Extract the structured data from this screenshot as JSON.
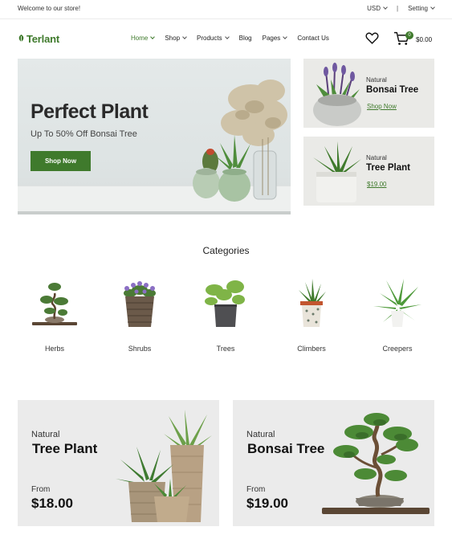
{
  "topbar": {
    "welcome": "Welcome to our store!",
    "currency": "USD",
    "separator": "|",
    "setting": "Setting"
  },
  "header": {
    "logo": "Terlant",
    "nav": [
      {
        "label": "Home",
        "dropdown": true,
        "active": true
      },
      {
        "label": "Shop",
        "dropdown": true
      },
      {
        "label": "Products",
        "dropdown": true
      },
      {
        "label": "Blog",
        "dropdown": false
      },
      {
        "label": "Pages",
        "dropdown": true
      },
      {
        "label": "Contact Us",
        "dropdown": false
      }
    ],
    "wishlist_icon": "heart-icon",
    "cart_icon": "cart-icon",
    "cart_count": "0",
    "cart_total": "$0.00"
  },
  "hero": {
    "title": "Perfect Plant",
    "subtitle": "Up To 50% Off Bonsai Tree",
    "button": "Shop Now"
  },
  "side_banners": [
    {
      "label": "Natural",
      "title": "Bonsai Tree",
      "link": "Shop Now"
    },
    {
      "label": "Natural",
      "title": "Tree Plant",
      "link": "$19.00"
    }
  ],
  "categories": {
    "heading": "Categories",
    "items": [
      {
        "label": "Herbs"
      },
      {
        "label": "Shrubs"
      },
      {
        "label": "Trees"
      },
      {
        "label": "Climbers"
      },
      {
        "label": "Creepers"
      }
    ]
  },
  "promos": [
    {
      "label": "Natural",
      "title": "Tree Plant",
      "from": "From",
      "price": "$18.00"
    },
    {
      "label": "Natural",
      "title": "Bonsai Tree",
      "from": "From",
      "price": "$19.00"
    }
  ],
  "colors": {
    "accent": "#3f7a2c",
    "banner_bg": "#eaeae7",
    "promo_bg": "#ebebeb"
  }
}
